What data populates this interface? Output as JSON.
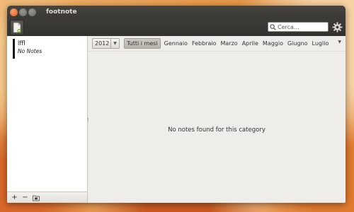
{
  "window": {
    "title": "footnote",
    "buttons": {
      "close": "×",
      "minimize": "–",
      "maximize": "+"
    }
  },
  "toolbar": {
    "new_note_icon": "new-note-icon",
    "search": {
      "placeholder": "Cerca..."
    },
    "settings_icon": "gear-icon"
  },
  "sidebar": {
    "categories": [
      {
        "name": "lffl",
        "count_label": "No Notes"
      }
    ],
    "footer": {
      "add": "+",
      "remove": "−",
      "folder_icon": "folder-icon"
    }
  },
  "filter": {
    "year": "2012",
    "months": [
      "Tutti i mesi",
      "Gennaio",
      "Febbraio",
      "Marzo",
      "Aprile",
      "Maggio",
      "Giugno",
      "Luglio"
    ],
    "active_month": "Tutti i mesi"
  },
  "main": {
    "empty_message": "No notes found for this category"
  },
  "colors": {
    "titlebar": "#3a3935",
    "window_bg": "#efedea",
    "accent_close": "#e25a1c"
  }
}
